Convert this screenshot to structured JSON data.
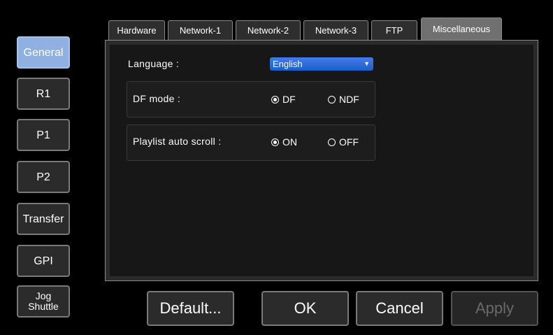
{
  "nav": {
    "general": "General",
    "r1": "R1",
    "p1": "P1",
    "p2": "P2",
    "transfer": "Transfer",
    "gpi": "GPI",
    "jog_line1": "Jog",
    "jog_line2": "Shuttle"
  },
  "tabs": {
    "hardware": "Hardware",
    "network1": "Network-1",
    "network2": "Network-2",
    "network3": "Network-3",
    "ftp": "FTP",
    "misc": "Miscellaneous"
  },
  "settings": {
    "language_label": "Language :",
    "language_value": "English",
    "df_mode_label": "DF mode :",
    "df_option": "DF",
    "ndf_option": "NDF",
    "df_selected": "DF",
    "playlist_label": "Playlist auto scroll :",
    "on_option": "ON",
    "off_option": "OFF",
    "playlist_selected": "ON"
  },
  "buttons": {
    "default": "Default...",
    "ok": "OK",
    "cancel": "Cancel",
    "apply": "Apply"
  },
  "colors": {
    "active_nav": "#8fb0e0",
    "active_tab": "#707070",
    "select_blue": "#2f6fdc"
  }
}
